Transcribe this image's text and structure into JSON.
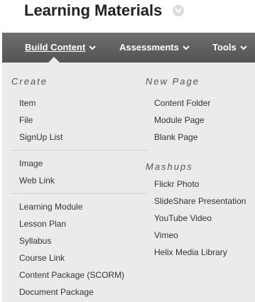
{
  "page": {
    "title": "Learning Materials"
  },
  "nav": {
    "items": [
      {
        "label": "Build Content",
        "active": true
      },
      {
        "label": "Assessments",
        "active": false
      },
      {
        "label": "Tools",
        "active": false
      }
    ]
  },
  "menu": {
    "create": {
      "heading": "Create",
      "group1": [
        "Item",
        "File",
        "SignUp List"
      ],
      "group2": [
        "Image",
        "Web Link"
      ],
      "group3": [
        "Learning Module",
        "Lesson Plan",
        "Syllabus",
        "Course Link",
        "Content Package (SCORM)",
        "Document Package"
      ]
    },
    "new_page": {
      "heading": "New Page",
      "items": [
        "Content Folder",
        "Module Page",
        "Blank Page"
      ]
    },
    "mashups": {
      "heading": "Mashups",
      "items": [
        "Flickr Photo",
        "SlideShare Presentation",
        "YouTube Video",
        "Vimeo",
        "Helix Media Library"
      ]
    }
  },
  "icons": {
    "title_menu": "chevron-down-icon",
    "nav_caret": "caret-down-icon"
  },
  "colors": {
    "nav_bar": "#5e5e5e",
    "menu_bg": "#ebebeb",
    "text": "#333333"
  }
}
